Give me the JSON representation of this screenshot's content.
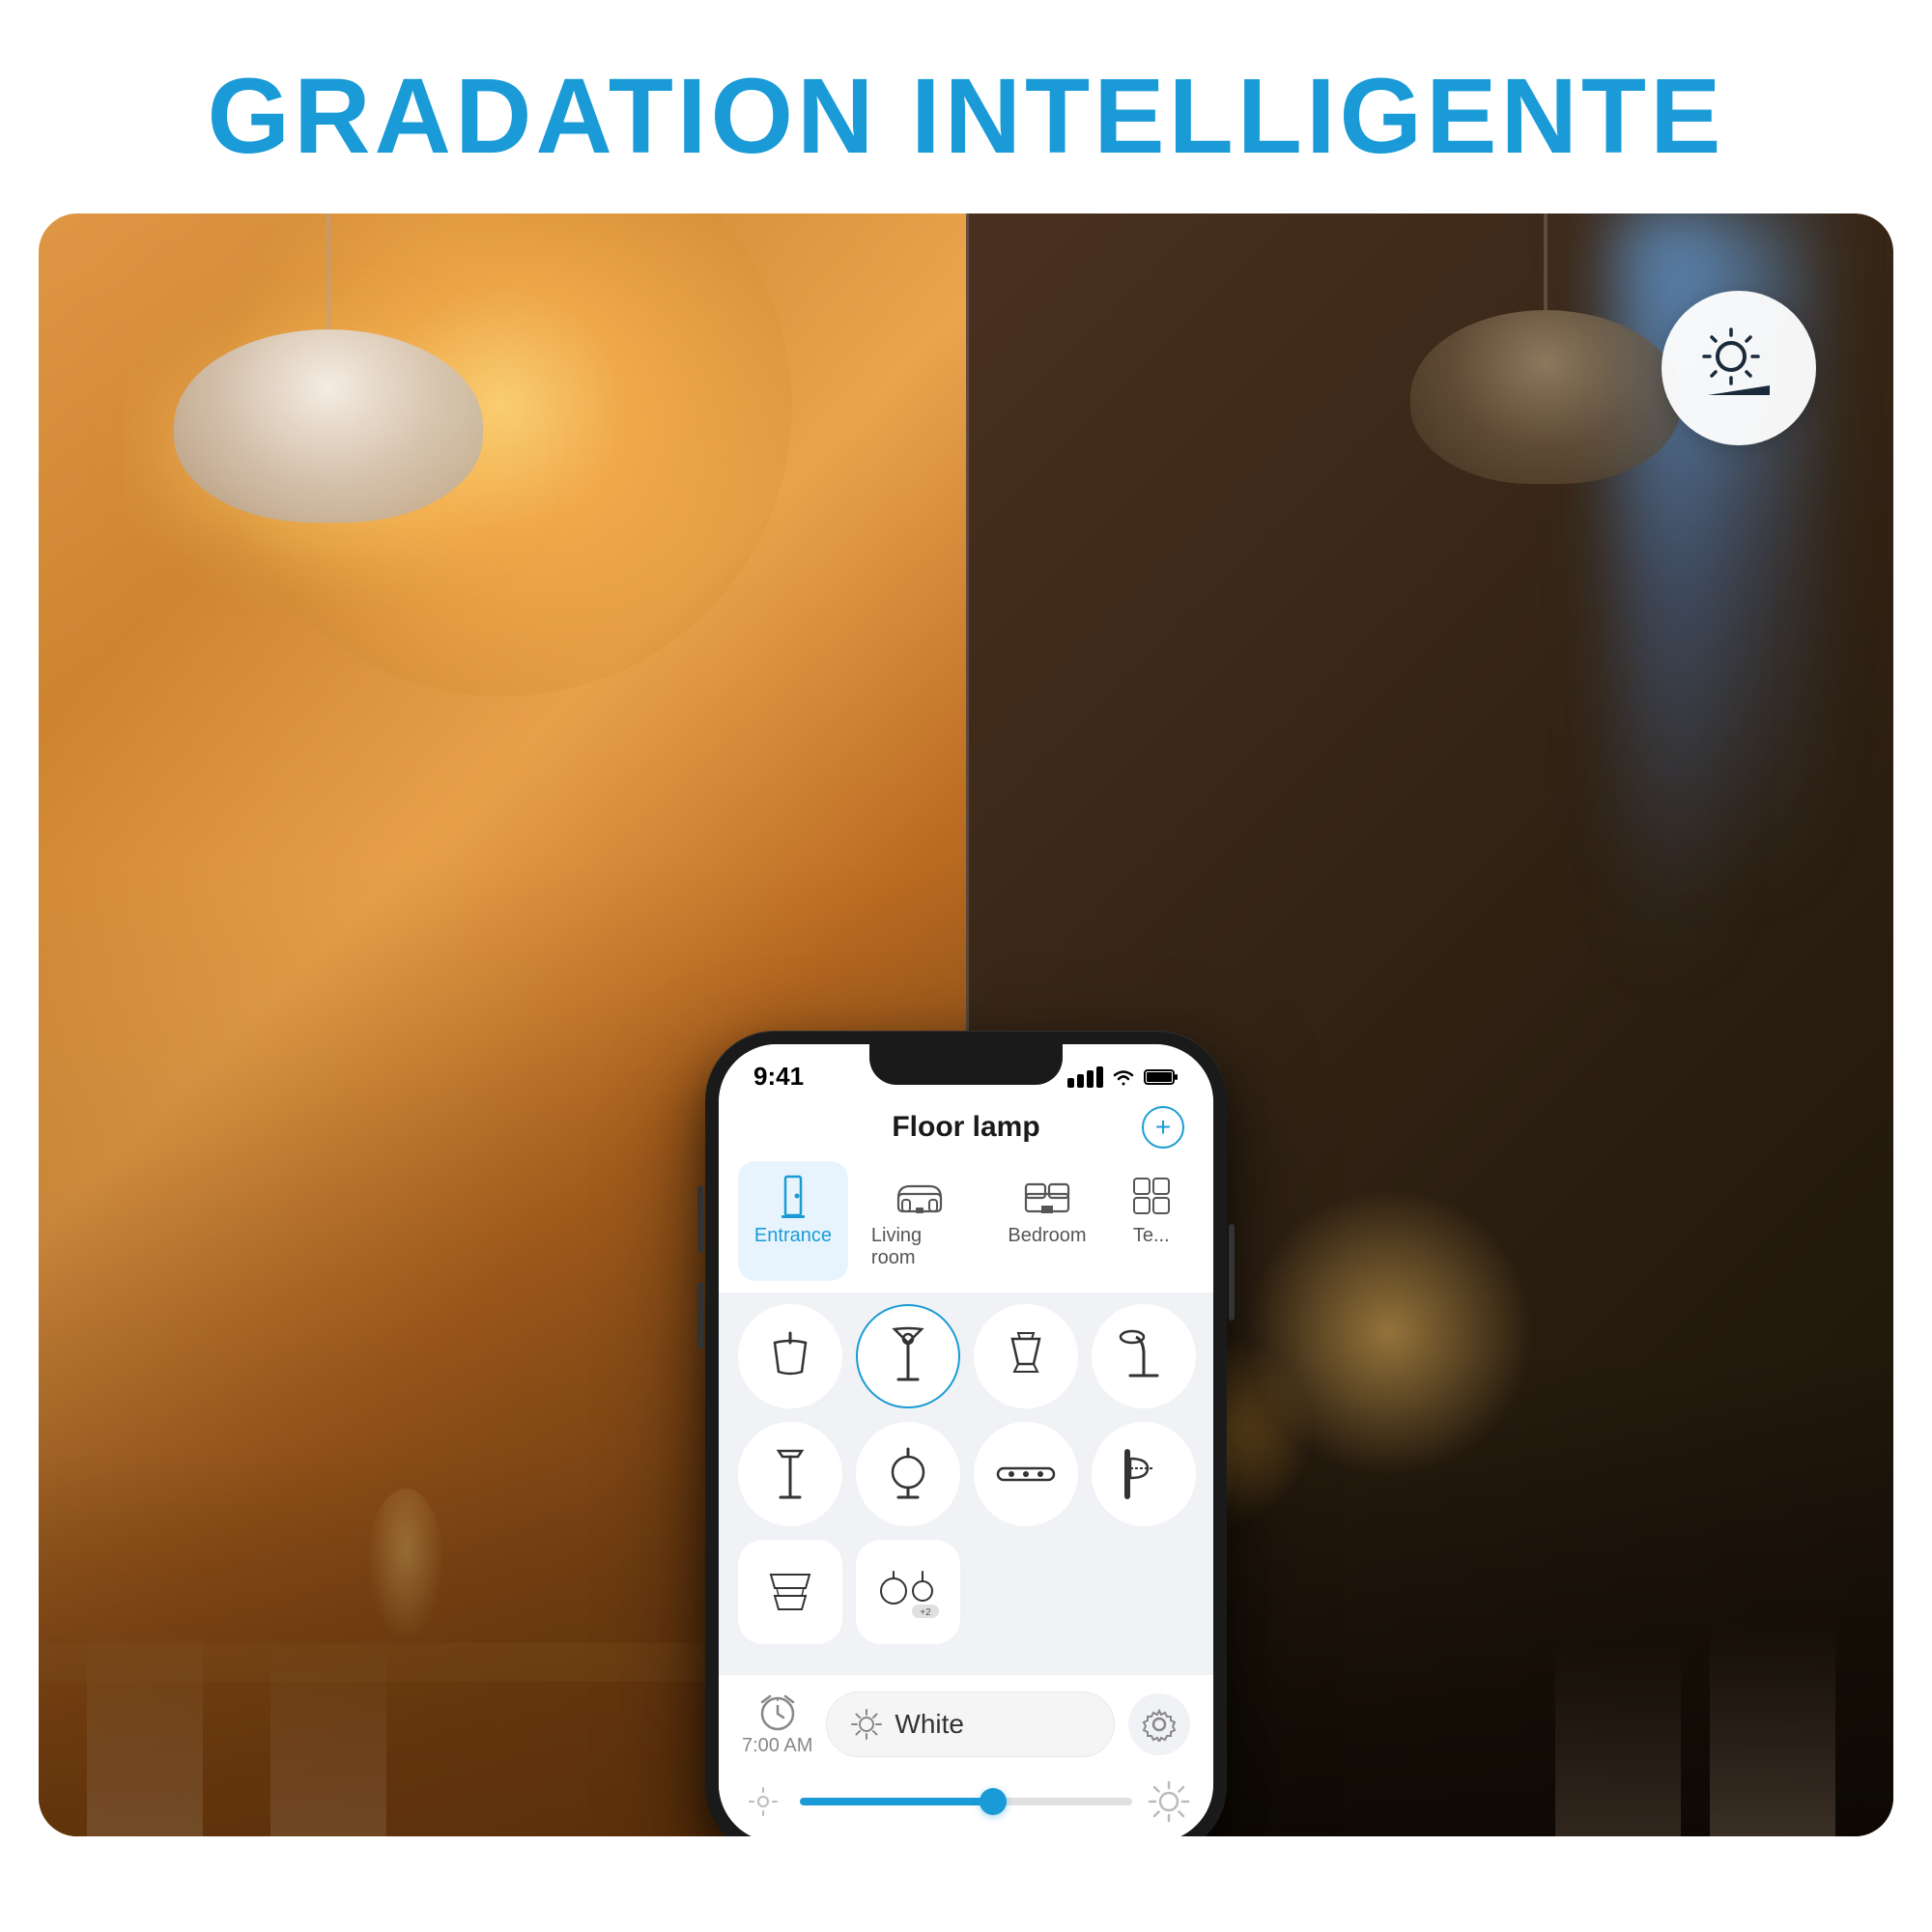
{
  "header": {
    "title": "GRADATION INTELLIGENTE",
    "title_color": "#1a9bd7"
  },
  "phone": {
    "status_bar": {
      "time": "9:41",
      "signal": "●●●●",
      "wifi": "wifi",
      "battery": "battery"
    },
    "app_title": "Floor lamp",
    "add_button": "+",
    "tabs": [
      {
        "label": "Entrance",
        "active": true
      },
      {
        "label": "Living room",
        "active": false
      },
      {
        "label": "Bedroom",
        "active": false
      },
      {
        "label": "Te...",
        "active": false
      }
    ],
    "icon_rows": [
      [
        "ceiling",
        "floor-lamp",
        "spot",
        "desk"
      ],
      [
        "floor-standing",
        "globe",
        "strip",
        "wall"
      ],
      [
        "multi-1",
        "multi-2",
        null,
        null
      ]
    ],
    "bottom": {
      "time_label": "7:00 AM",
      "white_text": "White",
      "sun_icon": "☀"
    },
    "slider": {
      "value_percent": 60
    }
  },
  "brightness_icon": {
    "label": "brightness-dimmer-icon"
  },
  "white_label": "White"
}
